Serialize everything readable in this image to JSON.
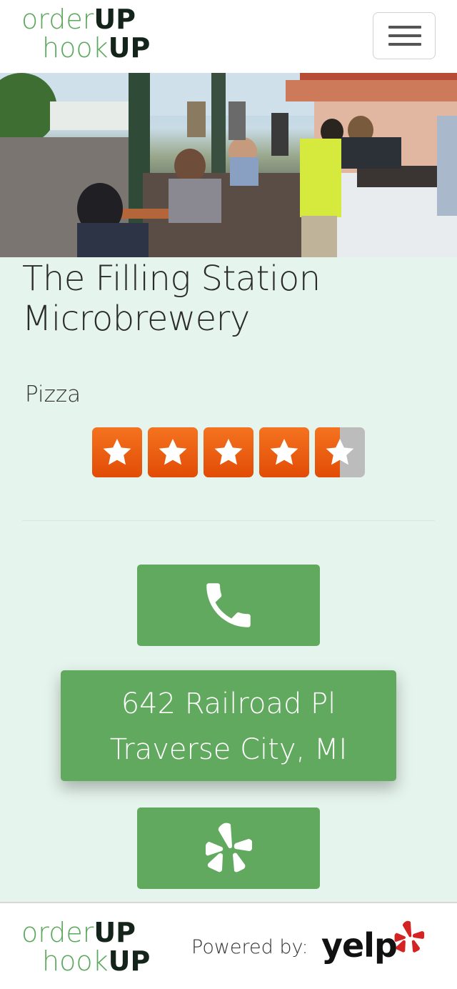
{
  "header": {
    "logo": {
      "line1_light": "order",
      "line1_bold": "UP",
      "line2_light": "hook",
      "line2_bold": "UP"
    },
    "menu_icon": "hamburger-icon"
  },
  "hero": {
    "image_alt_icon": "restaurant-photo"
  },
  "business": {
    "name": "The Filling Station Microbrewery",
    "category": "Pizza",
    "rating": 4.5,
    "rating_max": 5
  },
  "actions": {
    "phone_icon": "phone-icon",
    "address_line1": "642 Railroad Pl",
    "address_line2": "Traverse City, MI",
    "yelp_icon": "yelp-icon"
  },
  "footer": {
    "logo": {
      "line1_light": "order",
      "line1_bold": "UP",
      "line2_light": "hook",
      "line2_bold": "UP"
    },
    "powered_by": "Powered by:",
    "yelp_word": "yelp"
  },
  "colors": {
    "brand_green": "#5ba85c",
    "button_green": "#61a95e",
    "star_orange": "#f15c0c",
    "page_background": "#e5f4ec"
  }
}
